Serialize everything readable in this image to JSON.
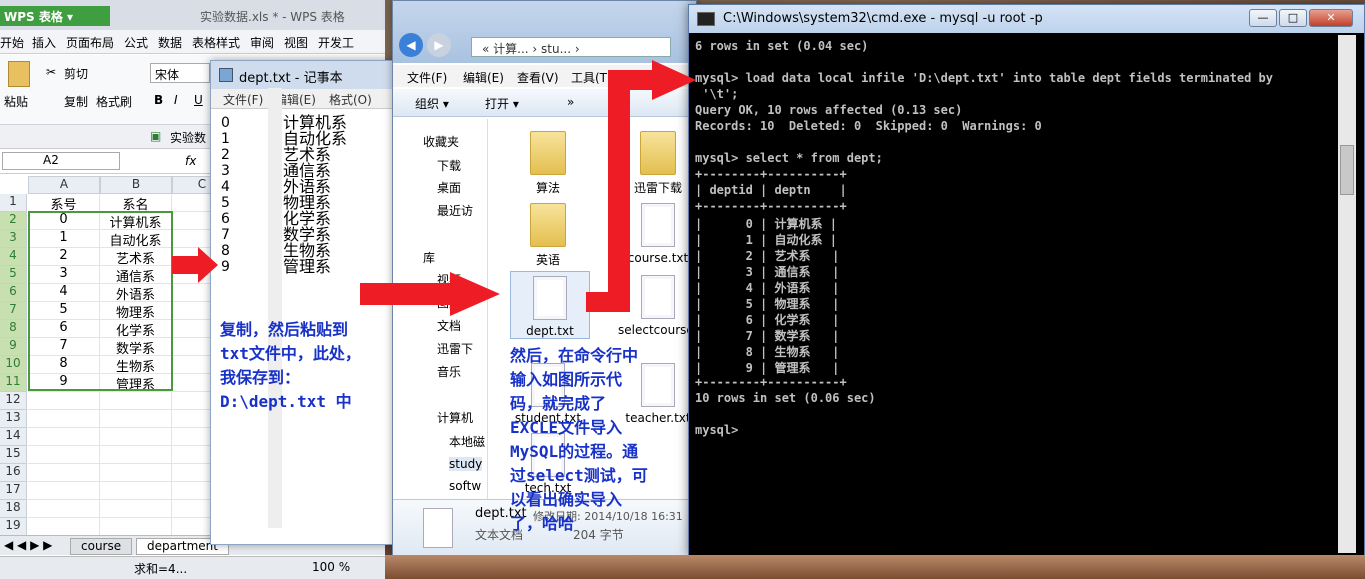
{
  "wps": {
    "app_name": "WPS 表格",
    "doc_title": "实验数据.xls * - WPS 表格",
    "menu": [
      "开始",
      "插入",
      "页面布局",
      "公式",
      "数据",
      "表格样式",
      "审阅",
      "视图",
      "开发工"
    ],
    "ribbon": {
      "cut": "剪切",
      "paste": "粘贴",
      "copy": "复制",
      "format_painter": "格式刷",
      "font": "宋体",
      "bold": "B",
      "italic": "I",
      "underline": "U"
    },
    "qat_doc": "实验数",
    "namebox": "A2",
    "fx": "fx",
    "columns": [
      "A",
      "B",
      "C"
    ],
    "rows": [
      {
        "n": "1",
        "a": "系号",
        "b": "系名"
      },
      {
        "n": "2",
        "a": "0",
        "b": "计算机系"
      },
      {
        "n": "3",
        "a": "1",
        "b": "自动化系"
      },
      {
        "n": "4",
        "a": "2",
        "b": "艺术系"
      },
      {
        "n": "5",
        "a": "3",
        "b": "通信系"
      },
      {
        "n": "6",
        "a": "4",
        "b": "外语系"
      },
      {
        "n": "7",
        "a": "5",
        "b": "物理系"
      },
      {
        "n": "8",
        "a": "6",
        "b": "化学系"
      },
      {
        "n": "9",
        "a": "7",
        "b": "数学系"
      },
      {
        "n": "10",
        "a": "8",
        "b": "生物系"
      },
      {
        "n": "11",
        "a": "9",
        "b": "管理系"
      },
      {
        "n": "12",
        "a": "",
        "b": ""
      },
      {
        "n": "13",
        "a": "",
        "b": ""
      },
      {
        "n": "14",
        "a": "",
        "b": ""
      },
      {
        "n": "15",
        "a": "",
        "b": ""
      },
      {
        "n": "16",
        "a": "",
        "b": ""
      },
      {
        "n": "17",
        "a": "",
        "b": ""
      },
      {
        "n": "18",
        "a": "",
        "b": ""
      },
      {
        "n": "19",
        "a": "",
        "b": ""
      }
    ],
    "sheet_tabs": [
      "course",
      "department"
    ],
    "status_sum": "求和=4...",
    "zoom": "100 %"
  },
  "notepad": {
    "title": "dept.txt - 记事本",
    "menu": [
      "文件(F)",
      "编辑(E)",
      "格式(O)"
    ],
    "lines": [
      {
        "id": "0",
        "name": "计算机系"
      },
      {
        "id": "1",
        "name": "自动化系"
      },
      {
        "id": "2",
        "name": "艺术系"
      },
      {
        "id": "3",
        "name": "通信系"
      },
      {
        "id": "4",
        "name": "外语系"
      },
      {
        "id": "5",
        "name": "物理系"
      },
      {
        "id": "6",
        "name": "化学系"
      },
      {
        "id": "7",
        "name": "数学系"
      },
      {
        "id": "8",
        "name": "生物系"
      },
      {
        "id": "9",
        "name": "管理系"
      }
    ]
  },
  "note1": [
    "复制，然后粘贴到",
    "txt文件中，此处，",
    "我保存到：",
    "D:\\dept.txt 中"
  ],
  "note2": [
    "然后，在命令行中",
    "输入如图所示代",
    "码，就完成了",
    "EXCLE文件导入",
    "MySQL的过程。通",
    "过select测试，可",
    "以看出确实导入",
    "了，哈哈"
  ],
  "explorer": {
    "address": "« 计算... › stu... ›",
    "menu": [
      "文件(F)",
      "编辑(E)",
      "查看(V)",
      "工具(T)"
    ],
    "organize": "组织 ▾",
    "open": "打开 ▾",
    "more": "»",
    "nav": [
      "收藏夹",
      "下载",
      "桌面",
      "最近访",
      "库",
      "视频",
      "图片",
      "文档",
      "迅雷下",
      "音乐",
      "计算机",
      "本地磁",
      "study",
      "softw"
    ],
    "files": [
      {
        "name": "算法",
        "type": "folder"
      },
      {
        "name": "迅雷下载",
        "type": "folder"
      },
      {
        "name": "英语",
        "type": "folder"
      },
      {
        "name": "course.txt",
        "type": "doc"
      },
      {
        "name": "dept.txt",
        "type": "doc"
      },
      {
        "name": "selectcourse.txt",
        "type": "doc"
      },
      {
        "name": "student.txt",
        "type": "doc"
      },
      {
        "name": "teacher.txt",
        "type": "doc"
      },
      {
        "name": "tech.txt",
        "type": "doc"
      }
    ],
    "details_name": "dept.txt",
    "details_date": "修改日期: 2014/10/18 16:31",
    "details_type": "文本文档",
    "details_size": "204 字节"
  },
  "cmd": {
    "title": "C:\\Windows\\system32\\cmd.exe - mysql  -u root -p",
    "lines": [
      "6 rows in set (0.04 sec)",
      "",
      "mysql> load data local infile 'D:\\dept.txt' into table dept fields terminated by",
      " '\\t';",
      "Query OK, 10 rows affected (0.13 sec)",
      "Records: 10  Deleted: 0  Skipped: 0  Warnings: 0",
      "",
      "mysql> select * from dept;",
      "+--------+----------+",
      "| deptid | deptn    |",
      "+--------+----------+",
      "|      0 | 计算机系 |",
      "|      1 | 自动化系 |",
      "|      2 | 艺术系   |",
      "|      3 | 通信系   |",
      "|      4 | 外语系   |",
      "|      5 | 物理系   |",
      "|      6 | 化学系   |",
      "|      7 | 数学系   |",
      "|      8 | 生物系   |",
      "|      9 | 管理系   |",
      "+--------+----------+",
      "10 rows in set (0.06 sec)",
      "",
      "mysql>"
    ]
  },
  "colors": {
    "arrow": "#ee1c24",
    "note": "#1832c8",
    "wps_green": "#3f9e3f"
  }
}
